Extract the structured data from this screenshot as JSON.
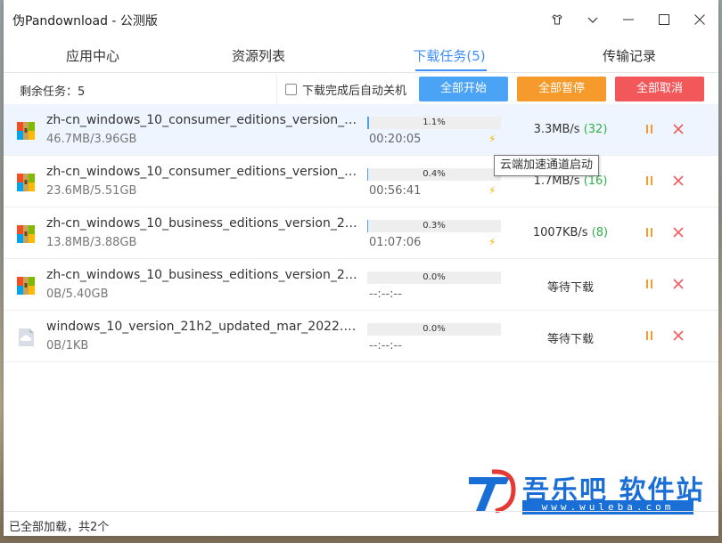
{
  "window": {
    "title": "伪Pandownload - 公测版"
  },
  "tabs": [
    {
      "label": "应用中心"
    },
    {
      "label": "资源列表"
    },
    {
      "label": "下载任务(5)"
    },
    {
      "label": "传输记录"
    }
  ],
  "toolbar": {
    "remaining": "剩余任务：5",
    "auto_shutdown_label": "下载完成后自动关机",
    "auto_shutdown_checked": false,
    "start_all": "全部开始",
    "pause_all": "全部暂停",
    "cancel_all": "全部取消"
  },
  "tasks": [
    {
      "name": "zh-cn_windows_10_consumer_editions_version_21h2_updated_mar_2022_x64_dvd.iso",
      "size": "46.7MB/3.96GB",
      "progress_text": "1.1%",
      "progress": 1.1,
      "time": "00:20:05",
      "accelerated": true,
      "speed": "3.3MB/s",
      "connections": "(32)",
      "status": "",
      "icon": "zip-icon",
      "selected": true
    },
    {
      "name": "zh-cn_windows_10_consumer_editions_version_21h2_updated_mar_2022_x86_dvd.iso",
      "size": "23.6MB/5.51GB",
      "progress_text": "0.4%",
      "progress": 0.4,
      "time": "00:56:41",
      "accelerated": true,
      "speed": "1.7MB/s",
      "connections": "(16)",
      "status": "",
      "icon": "zip-icon",
      "selected": false
    },
    {
      "name": "zh-cn_windows_10_business_editions_version_21h2_updated_mar_2022_x86_dvd.iso",
      "size": "13.8MB/3.88GB",
      "progress_text": "0.3%",
      "progress": 0.3,
      "time": "01:07:06",
      "accelerated": true,
      "speed": "1007KB/s",
      "connections": "(8)",
      "status": "",
      "icon": "zip-icon",
      "selected": false
    },
    {
      "name": "zh-cn_windows_10_business_editions_version_21h2_updated_mar_2022_x64_dvd.iso",
      "size": "0B/5.40GB",
      "progress_text": "0.0%",
      "progress": 0.0,
      "time": "--:--:--",
      "accelerated": false,
      "speed": "",
      "connections": "",
      "status": "等待下载",
      "icon": "zip-icon",
      "selected": false
    },
    {
      "name": "windows_10_version_21h2_updated_mar_2022.sha256",
      "size": "0B/1KB",
      "progress_text": "0.0%",
      "progress": 0.0,
      "time": "--:--:--",
      "accelerated": false,
      "speed": "",
      "connections": "",
      "status": "等待下载",
      "icon": "cloud-file-icon",
      "selected": false
    }
  ],
  "tooltip": "云端加速通道启动",
  "status_bar": "已全部加载，共2个",
  "watermark": {
    "title": "吾乐吧 软件站",
    "url": "www.wuleba.com"
  },
  "colors": {
    "accent": "#3e8ef7",
    "start": "#4ba3f5",
    "pause": "#f59a2b",
    "cancel": "#f2575a",
    "connections": "#2fb14a"
  }
}
